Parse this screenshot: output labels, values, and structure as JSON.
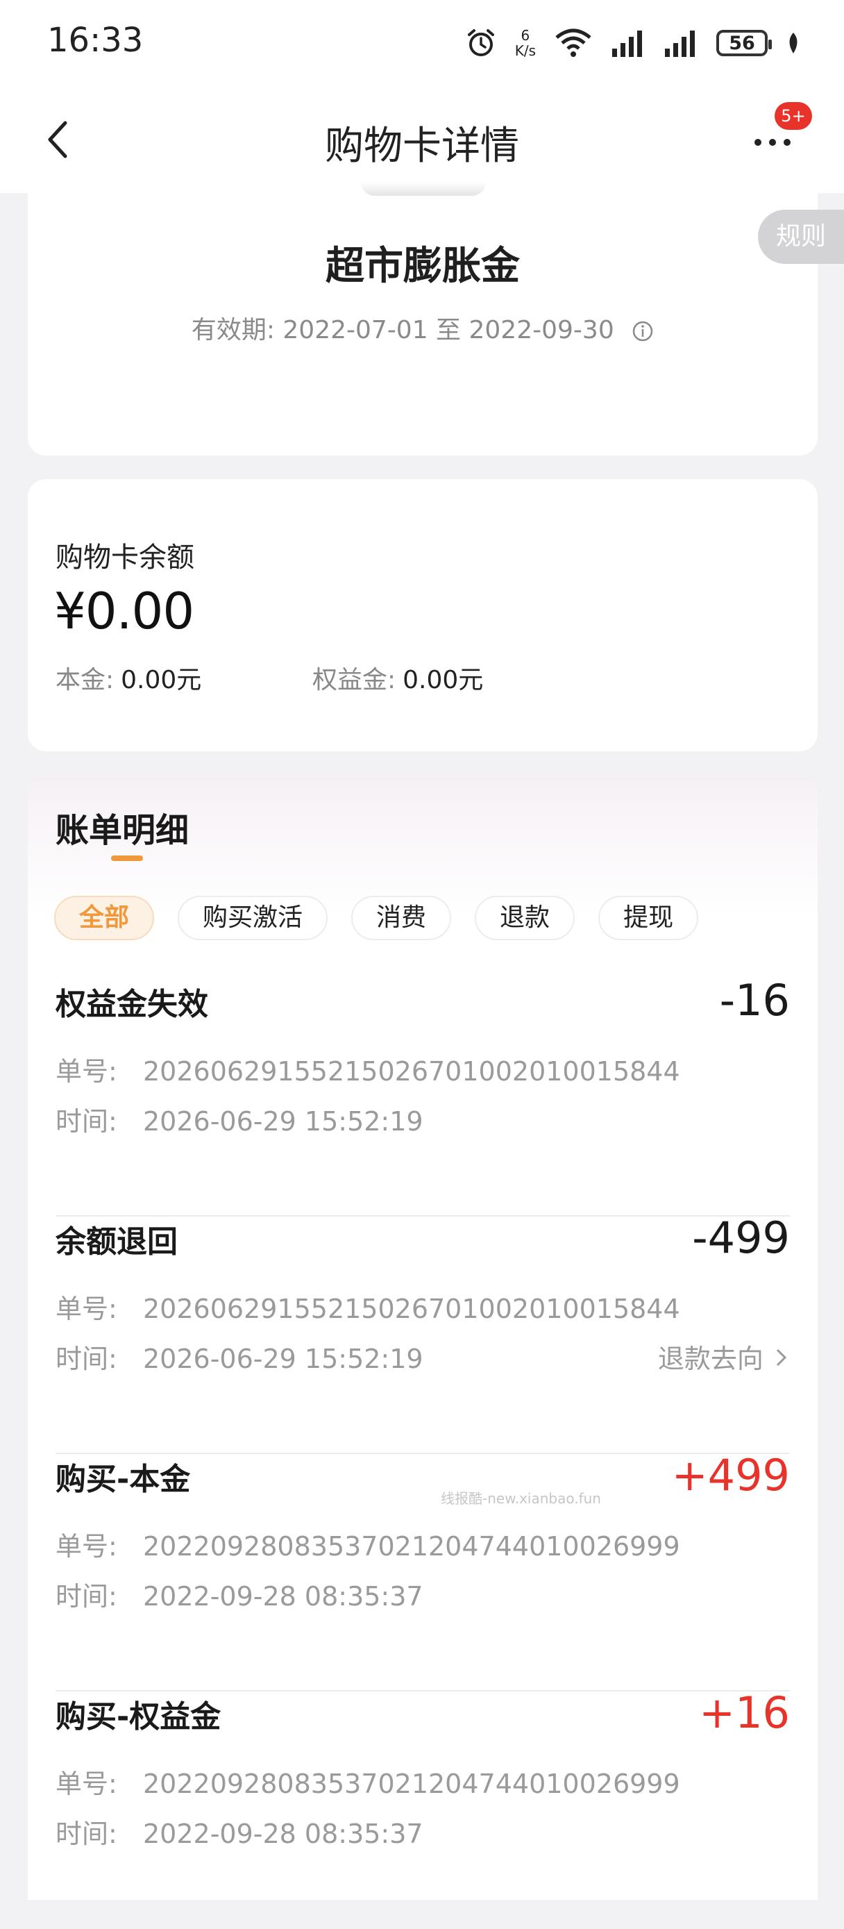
{
  "status_bar": {
    "time": "16:33",
    "net_speed_value": "6",
    "net_speed_unit": "K/s",
    "battery": "56",
    "icons": [
      "alarm-icon",
      "wifi-icon",
      "signal-icon",
      "signal-icon",
      "battery-icon",
      "leaf-icon"
    ]
  },
  "nav": {
    "title": "购物卡详情",
    "badge": "5+"
  },
  "card": {
    "name": "超市膨胀金",
    "validity": "有效期: 2022-07-01 至 2022-09-30",
    "rules": "规则"
  },
  "balance": {
    "label": "购物卡余额",
    "amount": "¥0.00",
    "principal_label": "本金:",
    "principal_value": "0.00元",
    "bonus_label": "权益金:",
    "bonus_value": "0.00元"
  },
  "bills": {
    "title": "账单明细",
    "filters": [
      "全部",
      "购买激活",
      "消费",
      "退款",
      "提现"
    ],
    "order_label": "单号:",
    "time_label": "时间:",
    "transactions": [
      {
        "title": "权益金失效",
        "amount": "-16",
        "order": "2026062915521502670100201001584 4",
        "time": "2026-06-29 15:52:19",
        "link": ""
      },
      {
        "title": "余额退回",
        "amount": "-499",
        "order": "20260629155215026701002010015844",
        "time": "2026-06-29 15:52:19",
        "link": "退款去向"
      },
      {
        "title": "购买-本金",
        "amount": "+499",
        "order": "20220928083537021204744010026999",
        "time": "2022-09-28 08:35:37",
        "link": ""
      },
      {
        "title": "购买-权益金",
        "amount": "+16",
        "order": "20220928083537021204744010026999",
        "time": "2022-09-28 08:35:37",
        "link": ""
      }
    ]
  },
  "watermark": "线报酷-new.xianbao.fun",
  "colors": {
    "accent": "#f0983c",
    "positive": "#e8332a",
    "badge": "#e8332a"
  }
}
